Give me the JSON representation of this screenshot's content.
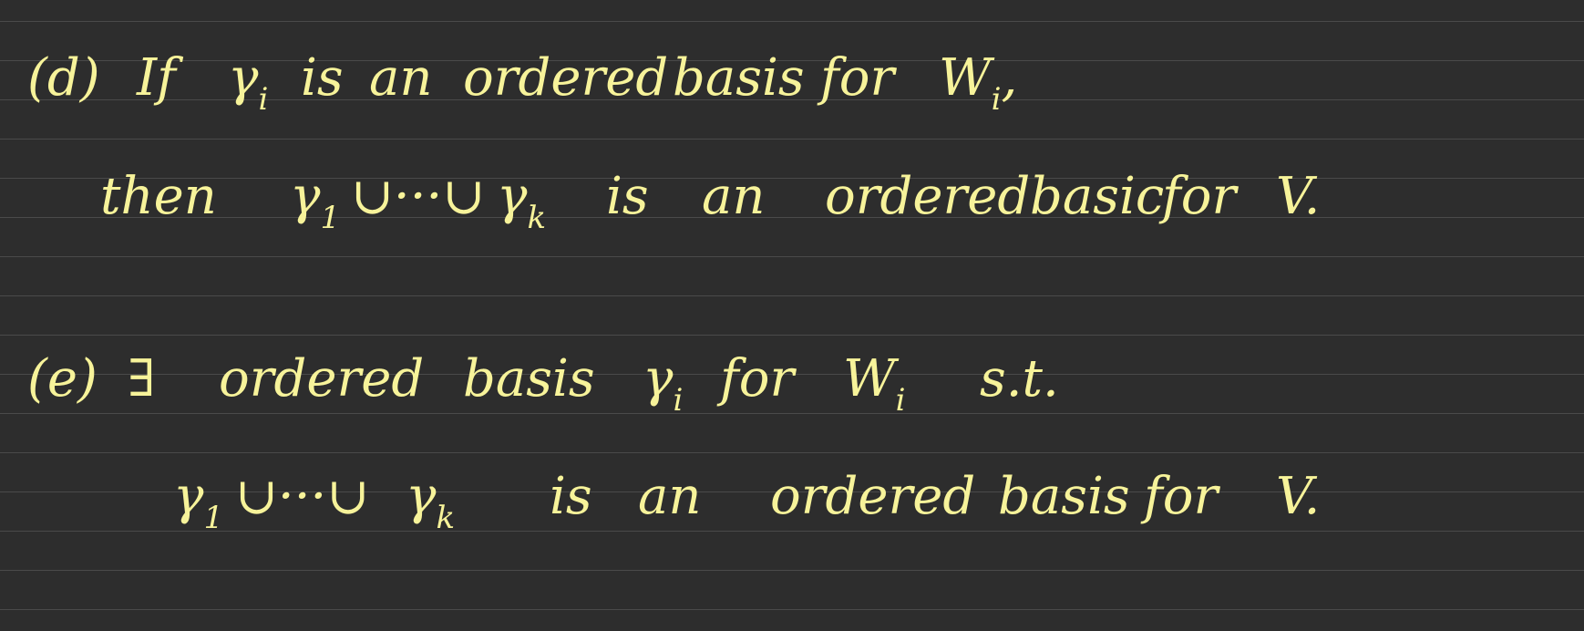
{
  "colors": {
    "background": "#2d2d2d",
    "ruling": "#4a4a4a",
    "ink": "#f7f39a"
  },
  "lines": {
    "d1": {
      "label": "(d)",
      "w1": "If",
      "gamma": "γ",
      "gamma_sub": "i",
      "w3": "is",
      "w4": "an",
      "w5": "ordered",
      "w6": "basis",
      "w7": "for",
      "W": "W",
      "W_sub": "i",
      "comma": ","
    },
    "d2": {
      "w1": "then",
      "g1": "γ",
      "g1_sub": "1",
      "union1": "∪···∪",
      "gk": "γ",
      "gk_sub": "k",
      "w3": "is",
      "w4": "an",
      "w5": "ordered",
      "w6": "basic",
      "w7": "for",
      "w8": "V."
    },
    "e1": {
      "label": "(e)",
      "exists": "∃",
      "w2": "ordered",
      "w3": "basis",
      "gamma": "γ",
      "gamma_sub": "i",
      "w5": "for",
      "W": "W",
      "W_sub": "i",
      "w7": "s.t."
    },
    "e2": {
      "g1": "γ",
      "g1_sub": "1",
      "union1": "∪···∪",
      "gk": "γ",
      "gk_sub": "k",
      "w3": "is",
      "w4": "an",
      "w5": "ordered",
      "w6": "basis",
      "w7": "for",
      "w8": "V."
    }
  }
}
